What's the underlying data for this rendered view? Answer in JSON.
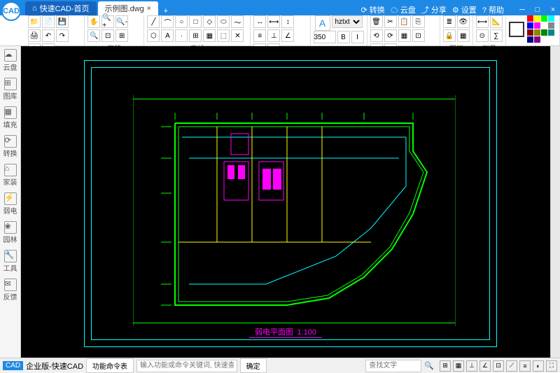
{
  "app": {
    "name": "快速CAD",
    "logo": "CAD"
  },
  "tabs": [
    {
      "label": "快速CAD-首页",
      "active": false
    },
    {
      "label": "示例图.dwg",
      "active": true
    }
  ],
  "titleRight": {
    "convert": "⟳ 转换",
    "cloud": "☁ 云盘",
    "share": "⤴ 分享",
    "settings": "⚙ 设置",
    "help": "? 帮助"
  },
  "toolbar": {
    "groups": {
      "file": {
        "label": "",
        "icons": [
          "📁",
          "📄",
          "💾",
          "🖨",
          "↶",
          "↷",
          "📋",
          "⬚"
        ]
      },
      "pan": {
        "label": "平移",
        "icons": [
          "✋",
          "🔍+",
          "🔍-",
          "🔍",
          "⊡",
          "⊞"
        ]
      },
      "line": {
        "label": "直线",
        "icons": [
          "╱",
          "⌒",
          "○",
          "□",
          "◇",
          "⬭",
          "～",
          "⬡",
          "A",
          "·",
          "⊞",
          "▦",
          "⬚",
          "✕"
        ]
      },
      "annotate": {
        "label": "标注",
        "icons": [
          "↔",
          "⟷",
          "↕",
          "≡",
          "⊥",
          "∠",
          "⊙",
          "⟳"
        ]
      },
      "text": {
        "label": "文字",
        "big": "A",
        "font": "hztxt",
        "size": "350",
        "bold": "B",
        "italic": "I"
      },
      "delete": {
        "label": "删除",
        "icons": [
          "🗑",
          "✂",
          "📋",
          "⎘",
          "⟲",
          "⟳",
          "▦",
          "⊡",
          "⬚",
          "▤"
        ]
      },
      "layer": {
        "label": "图层",
        "icons": [
          "≣",
          "👁",
          "🔒",
          "▦"
        ]
      },
      "measure": {
        "label": "测量",
        "icons": [
          "⟷",
          "📐",
          "⊙",
          "∑"
        ]
      },
      "color": {
        "label": "颜色"
      }
    }
  },
  "sidebar": [
    {
      "icon": "☁",
      "label": "云盘"
    },
    {
      "icon": "⊞",
      "label": "图库"
    },
    {
      "icon": "▦",
      "label": "填充"
    },
    {
      "icon": "⟳",
      "label": "转换"
    },
    {
      "icon": "⌂",
      "label": "家装"
    },
    {
      "icon": "⚡",
      "label": "弱电"
    },
    {
      "icon": "❀",
      "label": "园林"
    },
    {
      "icon": "🔧",
      "label": "工具"
    },
    {
      "icon": "✉",
      "label": "反馈"
    }
  ],
  "drawing": {
    "title": "弱电平面图",
    "scale": "1:100"
  },
  "statusbar": {
    "edition": "企业版-快速CAD",
    "cmdTable": "功能命令表",
    "cmdPlaceholder": "输入功能或命令关键词, 快速查找功能",
    "confirm": "确定",
    "searchPlaceholder": "查找文字"
  },
  "colors": [
    "#f00",
    "#ff0",
    "#0f0",
    "#0ff",
    "#00f",
    "#f0f",
    "#fff",
    "#888",
    "#800",
    "#880",
    "#080",
    "#088",
    "#008",
    "#808"
  ]
}
